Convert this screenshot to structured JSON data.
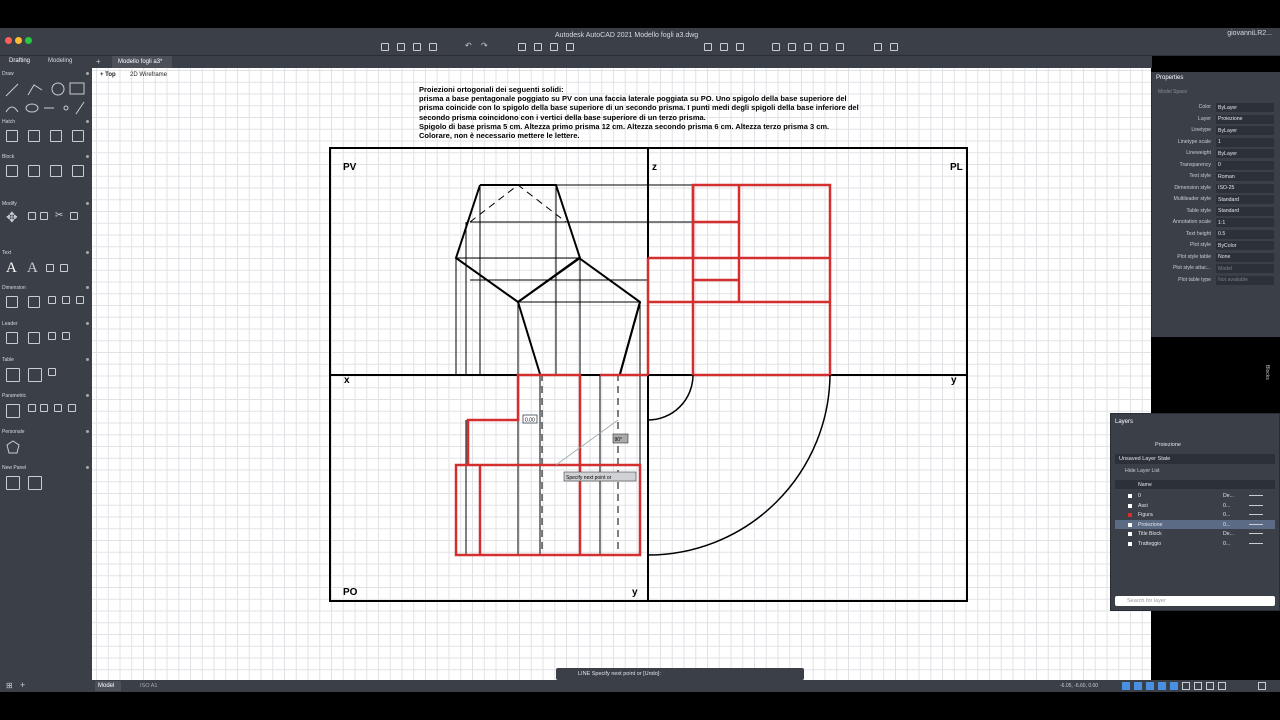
{
  "window": {
    "title": "Autodesk AutoCAD 2021   Modello fogli a3.dwg",
    "user": "giovanniLR2..."
  },
  "palette_tabs": [
    "Drafting",
    "Modeling"
  ],
  "palette_sections": [
    "Draw",
    "Hatch",
    "Block",
    "Modify",
    "Text",
    "Dimension",
    "Leader",
    "Table",
    "Parametric",
    "Personale",
    "New Panel"
  ],
  "document_tab": "Modello fogli a3*",
  "viewport": {
    "view": "Top",
    "visual_style": "2D Wireframe"
  },
  "instructions": [
    "Proiezioni ortogonali dei seguenti solidi:",
    "prisma a base pentagonale poggiato su PV con una faccia laterale poggiata su PO. Uno spigolo della base superiore del",
    "prisma coincide con lo spigolo della base superiore di un secondo prisma. I punti medi degli spigoli della base inferiore del",
    "secondo prisma coincidono con i vertici della base superiore di un terzo prisma.",
    "Spigolo di base prisma 5 cm. Altezza primo prisma 12 cm. Altezza secondo prisma 6 cm. Altezza terzo prisma 3 cm.",
    "Colorare, non è necessario mettere le lettere."
  ],
  "drawing_labels": {
    "pv": "PV",
    "pl": "PL",
    "po": "PO",
    "x": "x",
    "y_right": "y",
    "y_bottom": "y",
    "z": "z",
    "input_value": "0.00",
    "angle_value": "90°",
    "prompt_tooltip": "Specify next point or"
  },
  "properties": {
    "title": "Properties",
    "subtitle": "Model Space",
    "rows": [
      {
        "k": "Color",
        "v": "ByLayer"
      },
      {
        "k": "Layer",
        "v": "Proiezione"
      },
      {
        "k": "Linetype",
        "v": "ByLayer"
      },
      {
        "k": "Linetype scale",
        "v": "1"
      },
      {
        "k": "Lineweight",
        "v": "ByLayer"
      },
      {
        "k": "Transparency",
        "v": "0"
      },
      {
        "k": "Text style",
        "v": "Roman"
      },
      {
        "k": "Dimension style",
        "v": "ISO-25"
      },
      {
        "k": "Multileader style",
        "v": "Standard"
      },
      {
        "k": "Table style",
        "v": "Standard"
      },
      {
        "k": "Annotation scale",
        "v": "1:1"
      },
      {
        "k": "Text height",
        "v": "0.5"
      },
      {
        "k": "Plot style",
        "v": "ByColor"
      },
      {
        "k": "Plot style table",
        "v": "None"
      },
      {
        "k": "Plot style attac...",
        "v": "Model"
      },
      {
        "k": "Plot table type",
        "v": "Not available"
      }
    ]
  },
  "layers": {
    "title": "Layers",
    "current": "Proiezione",
    "state": "Unsaved Layer State",
    "hide_list": "Hide Layer List",
    "header_name": "Name",
    "rows": [
      {
        "name": "0",
        "color": "De...",
        "swatch": "#ffffff"
      },
      {
        "name": "Assi",
        "color": "0...",
        "swatch": "#ffffff"
      },
      {
        "name": "Figura",
        "color": "0...",
        "swatch": "#d32f2f"
      },
      {
        "name": "Proiezione",
        "color": "0...",
        "swatch": "#ffffff"
      },
      {
        "name": "Title Block",
        "color": "De...",
        "swatch": "#ffffff"
      },
      {
        "name": "Tratteggio",
        "color": "0...",
        "swatch": "#ffffff"
      }
    ],
    "search_placeholder": "Search for layer"
  },
  "statusbar": {
    "model_tab": "Model",
    "paper": "ISO A1",
    "coords": "-6.05, -6.60, 0.00"
  },
  "command_line": "LINE Specify next point or [Undo]:",
  "side_tab": "Blocks",
  "colors": {
    "accent_red": "#d32f2f",
    "panel": "#3a3f48"
  }
}
